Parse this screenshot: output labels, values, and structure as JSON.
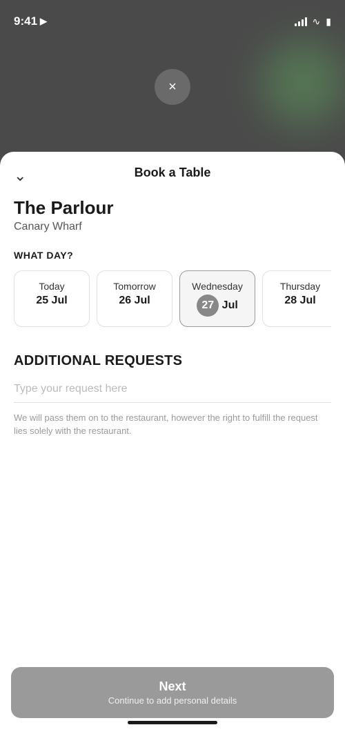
{
  "statusBar": {
    "time": "9:41",
    "locationIcon": "▶"
  },
  "closeButton": {
    "label": "×"
  },
  "sheet": {
    "title": "Book a Table",
    "chevronLabel": "❯"
  },
  "restaurant": {
    "name": "The Parlour",
    "location": "Canary Wharf"
  },
  "whatDay": {
    "label": "WHAT DAY?",
    "dates": [
      {
        "dayName": "Today",
        "dayNum": "25 Jul",
        "selected": false
      },
      {
        "dayName": "Tomorrow",
        "dayNum": "26 Jul",
        "selected": false
      },
      {
        "dayName": "Wednesday",
        "dayNum": "27 Jul",
        "selected": true
      },
      {
        "dayName": "Thursday",
        "dayNum": "28 Jul",
        "selected": false
      }
    ]
  },
  "additionalRequests": {
    "title": "ADDITIONAL REQUESTS",
    "placeholder": "Type your request here",
    "note": "We will pass them on to the restaurant, however the right to fulfill the request lies solely with the restaurant."
  },
  "nextButton": {
    "label": "Next",
    "sublabel": "Continue to add personal details"
  },
  "colors": {
    "selectedHighlight": "#888888",
    "nextBtnBg": "#9a9a9a"
  }
}
